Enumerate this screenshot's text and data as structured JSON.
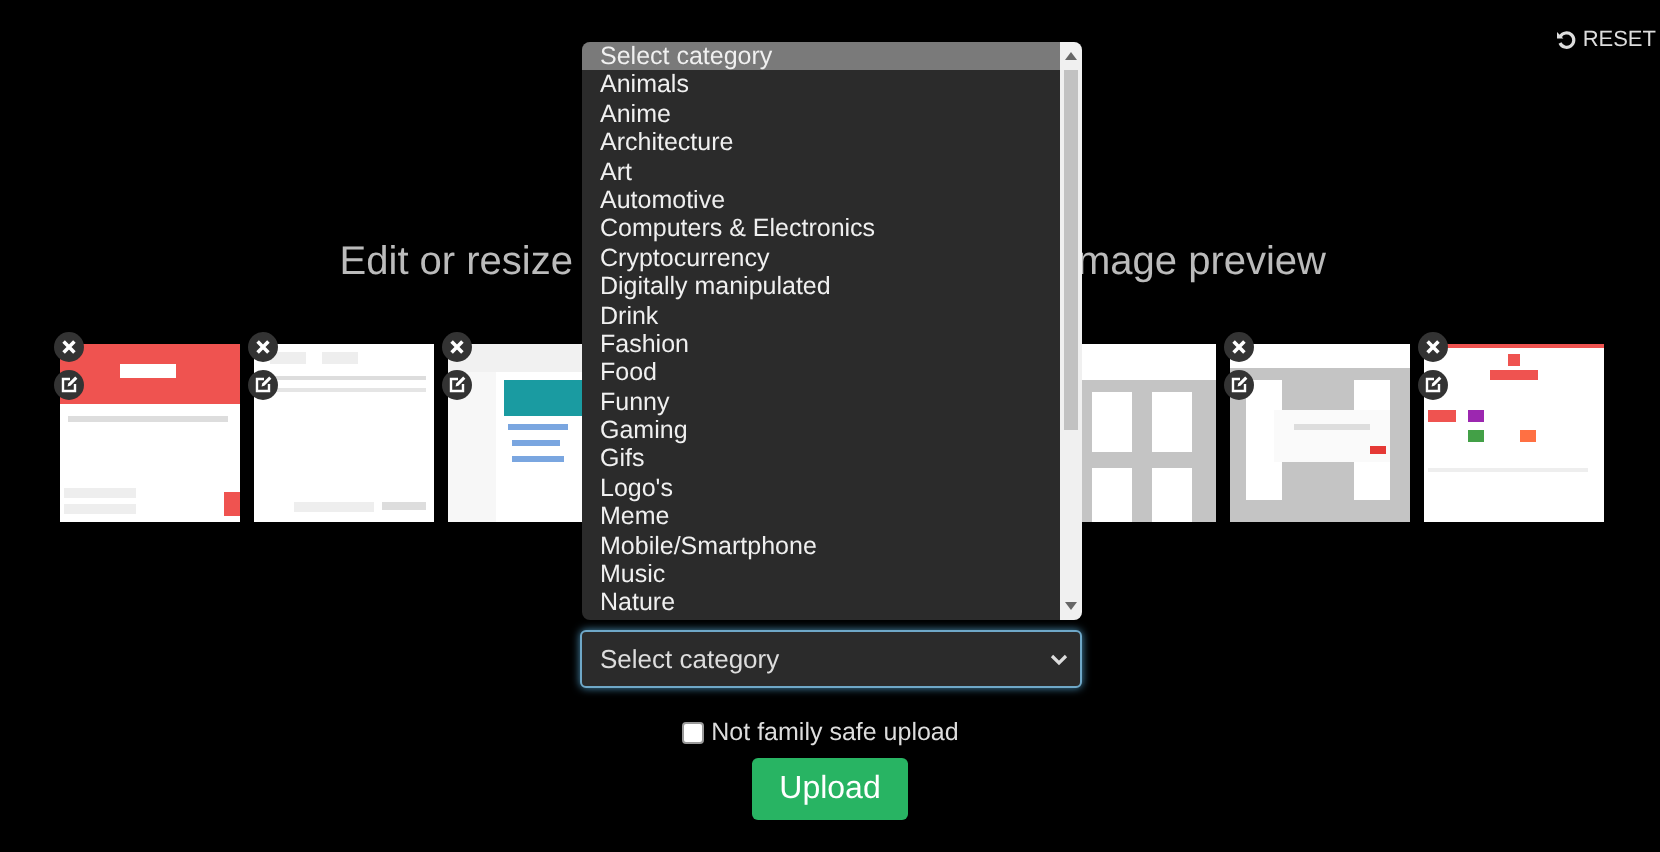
{
  "reset": {
    "label": "RESET"
  },
  "heading": {
    "left": "Edit or resize",
    "right": "mage preview"
  },
  "thumbnails": [
    {
      "kind": "picture"
    },
    {
      "kind": "picture"
    },
    {
      "kind": "picture"
    },
    {
      "kind": "picture-cut"
    },
    {
      "kind": "picture"
    },
    {
      "kind": "picture"
    }
  ],
  "category_list": {
    "options": [
      {
        "label": "Select category",
        "selected": true
      },
      {
        "label": "Animals",
        "selected": false
      },
      {
        "label": "Anime",
        "selected": false
      },
      {
        "label": "Architecture",
        "selected": false
      },
      {
        "label": "Art",
        "selected": false
      },
      {
        "label": "Automotive",
        "selected": false
      },
      {
        "label": "Computers & Electronics",
        "selected": false
      },
      {
        "label": "Cryptocurrency",
        "selected": false
      },
      {
        "label": "Digitally manipulated",
        "selected": false
      },
      {
        "label": "Drink",
        "selected": false
      },
      {
        "label": "Fashion",
        "selected": false
      },
      {
        "label": "Food",
        "selected": false
      },
      {
        "label": "Funny",
        "selected": false
      },
      {
        "label": "Gaming",
        "selected": false
      },
      {
        "label": "Gifs",
        "selected": false
      },
      {
        "label": "Logo's",
        "selected": false
      },
      {
        "label": "Meme",
        "selected": false
      },
      {
        "label": "Mobile/Smartphone",
        "selected": false
      },
      {
        "label": "Music",
        "selected": false
      },
      {
        "label": "Nature",
        "selected": false
      }
    ]
  },
  "category_select": {
    "value": "Select category"
  },
  "family_safe": {
    "label": "Not family safe upload",
    "checked": false
  },
  "upload_button": {
    "label": "Upload"
  }
}
